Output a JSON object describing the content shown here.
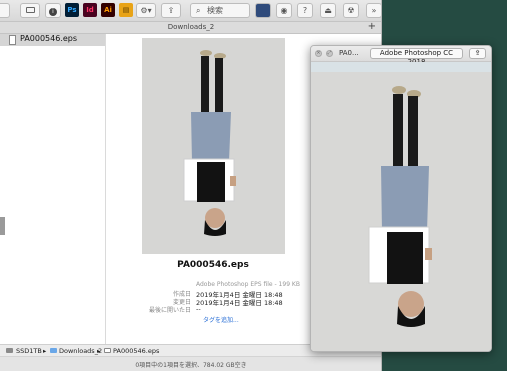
{
  "toolbar": {
    "search_placeholder": "検索",
    "apps": [
      "Ps",
      "Id",
      "Ai"
    ]
  },
  "window": {
    "tab_title": "Downloads_2",
    "new_tab": "+"
  },
  "sidebar": {
    "file": "PA000546.eps"
  },
  "preview": {
    "filename": "PA000546.eps",
    "kind": "Adobe Photoshop EPS file - 199 KB",
    "meta": [
      {
        "label": "作成日",
        "value": "2019年1月4日 金曜日 18:48"
      },
      {
        "label": "変更日",
        "value": "2019年1月4日 金曜日 18:48"
      },
      {
        "label": "最後に開いた日",
        "value": "--"
      }
    ],
    "tags_link": "タグを追加..."
  },
  "pathbar": {
    "items": [
      "SSD1TB",
      "Downloads_2",
      "PA000546.eps"
    ],
    "separator": "▸"
  },
  "status": {
    "text": "0項目中の1項目を選択、784.02 GB空き"
  },
  "quicklook": {
    "title": "PA0...",
    "open_with": "Adobe Photoshop CC 2018"
  },
  "colors": {
    "desktop": "#254b42",
    "ps": "#31a8ff",
    "id": "#ff3366",
    "ai": "#ff9a00"
  }
}
